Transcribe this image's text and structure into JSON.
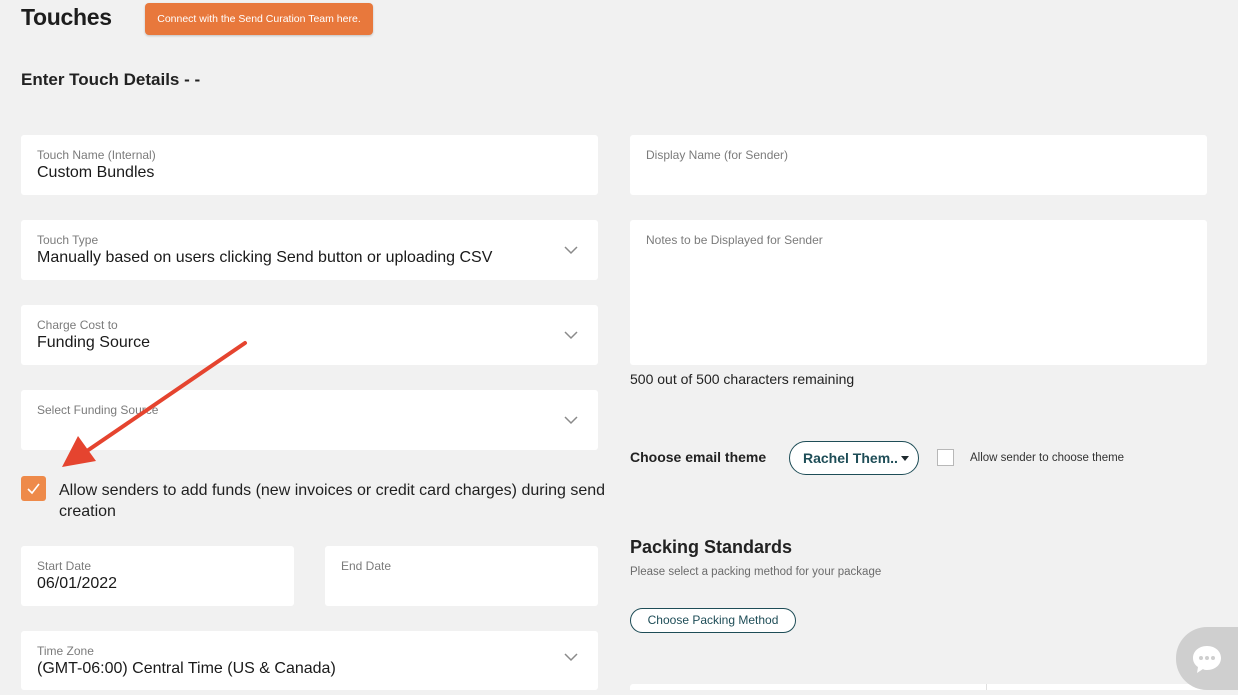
{
  "header": {
    "title": "Touches",
    "cta_label": "Connect with the Send Curation Team here.",
    "subtitle": "Enter Touch Details - -"
  },
  "form": {
    "touch_name": {
      "label": "Touch Name (Internal)",
      "value": "Custom Bundles"
    },
    "display_name": {
      "label": "Display Name (for Sender)",
      "value": ""
    },
    "touch_type": {
      "label": "Touch Type",
      "value": "Manually based on users clicking Send button or uploading CSV"
    },
    "notes": {
      "label": "Notes to be Displayed for Sender",
      "value": ""
    },
    "charge_cost": {
      "label": "Charge Cost to",
      "value": "Funding Source"
    },
    "funding_source": {
      "label": "Select Funding Source",
      "value": ""
    },
    "chars_remaining": "500 out of 500 characters remaining",
    "allow_funds": {
      "label": "Allow senders to add funds (new invoices or credit card charges) during send creation",
      "checked": true
    },
    "email_theme": {
      "label": "Choose email theme",
      "selected": "Rachel Them..",
      "allow_sender_label": "Allow sender to choose theme",
      "allow_sender_checked": false
    },
    "start_date": {
      "label": "Start Date",
      "value": "06/01/2022"
    },
    "end_date": {
      "label": "End Date",
      "value": ""
    },
    "time_zone": {
      "label": "Time Zone",
      "value": "(GMT-06:00) Central Time (US & Canada)"
    }
  },
  "packing": {
    "title": "Packing Standards",
    "subtitle": "Please select a packing method for your package",
    "button_label": "Choose Packing Method"
  },
  "colors": {
    "accent": "#e8783c",
    "checkbox": "#ee8a4a",
    "teal": "#1e4d57",
    "annotation_arrow": "#e5442f"
  },
  "icons": [
    "chevron-down-icon",
    "checkmark-icon",
    "caret-down-icon",
    "chat-bubble-icon",
    "annotation-arrow"
  ]
}
